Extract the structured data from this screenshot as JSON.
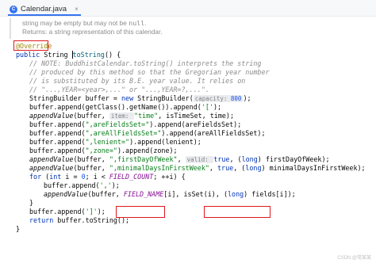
{
  "tab": {
    "icon": "java-class-icon",
    "label": "Calendar.java",
    "close": "×"
  },
  "doc": {
    "line1_pre": "string may be empty but may not be ",
    "line1_code": "null",
    "line1_post": ".",
    "line2": "Returns: a string representation of this calendar."
  },
  "code": {
    "annotation": "@Override",
    "l_decl_kw": "public ",
    "l_decl_type": "String ",
    "l_decl_name": "toString",
    "l_decl_rest": "() {",
    "c1": "// NOTE: BuddhistCalendar.toString() interprets the string",
    "c2": "// produced by this method so that the Gregorian year number",
    "c3": "// is substituted by its B.E. year value. It relies on",
    "c4": "// \"...,YEAR=<year>,...\" or \"...,YEAR=?,...\".",
    "sb_pre": "StringBuilder buffer = ",
    "sb_kw": "new ",
    "sb_post": "StringBuilder(",
    "sb_hint": "capacity: ",
    "sb_num": "800",
    "sb_end": ");",
    "l_getclass_pre": "buffer.append(getClass().getName()).append(",
    "l_getclass_str": "'['",
    "l_getclass_end": ");",
    "av_fn": "appendValue",
    "av1_args": "(buffer, ",
    "av1_hint": "item: ",
    "av1_str": "\"time\"",
    "av1_post": ", isTimeSet, time);",
    "ap_pre": "buffer.append(",
    "ap2_str": "\",areFieldsSet=\"",
    "ap2_post": ").append(areFieldsSet);",
    "ap3_str": "\",areAllFieldsSet=\"",
    "ap3_post": ").append(areAllFieldsSet);",
    "ap4_str": "\",lenient=\"",
    "ap4_post": ").append(lenient);",
    "ap5_str": "\",zone=\"",
    "ap5_post": ").append(zone);",
    "av2_str": "\",firstDayOfWeek\"",
    "av2_hint": "valid: ",
    "av2_true": "true",
    "av2_mid": ", (",
    "av2_long": "long",
    "av2_end": ") firstDayOfWeek);",
    "av3_str": "\",minimalDaysInFirstWeek\"",
    "av3_end": ") minimalDaysInFirstWeek);",
    "for_kw": "for ",
    "for_open": "(",
    "for_int": "int ",
    "for_mid1": "i = ",
    "for_zero": "0",
    "for_mid2": "; i < ",
    "for_const": "FIELD_COUNT",
    "for_end": "; ++i) {",
    "ap_comma_str": "','",
    "ap_comma_end": ");",
    "av4_pre": "(buffer, ",
    "av4_field": "FIELD_NAME",
    "av4_idx": "[i]",
    "av4_mid": ", isSet(i), ",
    "av4_long_open": "(",
    "av4_long": "long",
    "av4_fields": ") fields[i]",
    "av4_end": ");",
    "close_brace": "}",
    "ap_bracket_str": "']'",
    "ap_bracket_end": ");",
    "ret_kw": "return ",
    "ret_post": "buffer.toString();",
    "final_brace": "}"
  },
  "watermark": "CSDN @常某某",
  "colors": {
    "highlight_box": "#e0191b",
    "keyword": "#0033b3",
    "string": "#067d17",
    "comment": "#8c8c8c",
    "annotation": "#9e880d"
  }
}
